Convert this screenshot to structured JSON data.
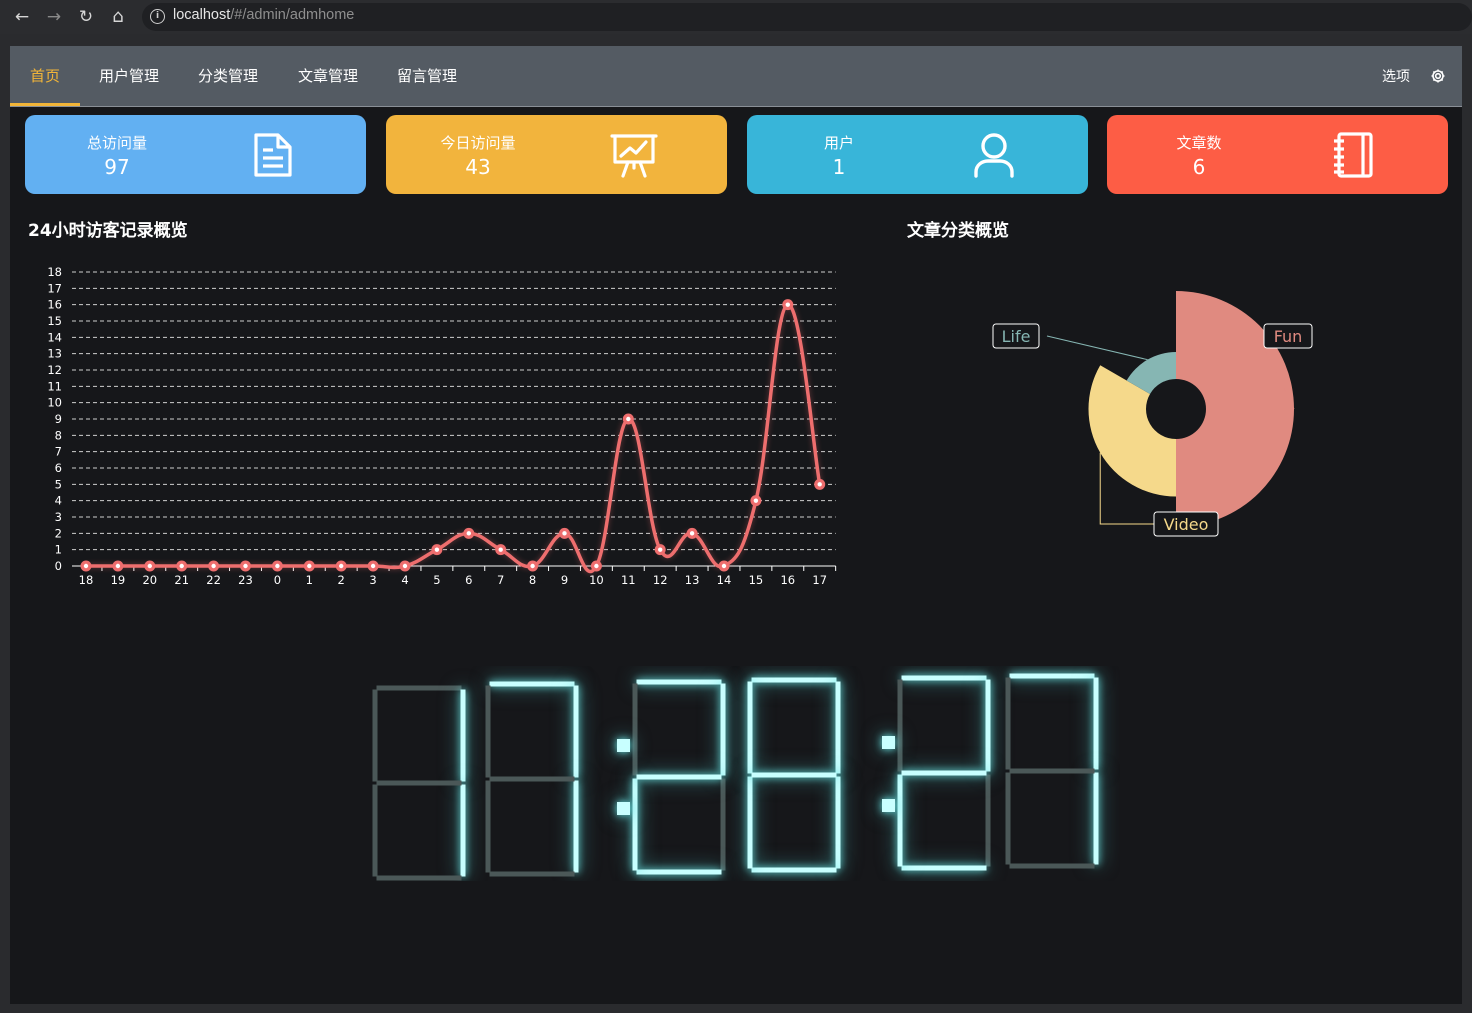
{
  "browser": {
    "url_host": "localhost",
    "url_path": "/#/admin/admhome",
    "icons": [
      "back-arrow-icon",
      "forward-arrow-icon",
      "reload-icon",
      "home-icon",
      "info-icon"
    ]
  },
  "nav": {
    "items": [
      {
        "label": "首页",
        "active": true
      },
      {
        "label": "用户管理",
        "active": false
      },
      {
        "label": "分类管理",
        "active": false
      },
      {
        "label": "文章管理",
        "active": false
      },
      {
        "label": "留言管理",
        "active": false
      }
    ],
    "options_label": "选项",
    "active_color": "#f2b538"
  },
  "cards": [
    {
      "label": "总访问量",
      "value": "97",
      "color": "#62b0f2",
      "icon": "document-icon"
    },
    {
      "label": "今日访问量",
      "value": "43",
      "color": "#f2b43d",
      "icon": "presentation-chart-icon"
    },
    {
      "label": "用户",
      "value": "1",
      "color": "#38b5d9",
      "icon": "user-icon"
    },
    {
      "label": "文章数",
      "value": "6",
      "color": "#fd5d45",
      "icon": "notebook-icon"
    }
  ],
  "sections": {
    "visits_title": "24小时访客记录概览",
    "category_title": "文章分类概览"
  },
  "chart_data": [
    {
      "type": "line",
      "title": "24小时访客记录概览",
      "categories": [
        "18",
        "19",
        "20",
        "21",
        "22",
        "23",
        "0",
        "1",
        "2",
        "3",
        "4",
        "5",
        "6",
        "7",
        "8",
        "9",
        "10",
        "11",
        "12",
        "13",
        "14",
        "15",
        "16",
        "17"
      ],
      "series": [
        {
          "values": [
            0,
            0,
            0,
            0,
            0,
            0,
            0,
            0,
            0,
            0,
            0,
            1,
            2,
            1,
            0,
            2,
            0,
            9,
            1,
            2,
            0,
            4,
            16,
            5
          ]
        }
      ],
      "ylim": [
        0,
        18
      ],
      "y_ticks": [
        0,
        1,
        2,
        3,
        4,
        5,
        6,
        7,
        8,
        9,
        10,
        11,
        12,
        13,
        14,
        15,
        16,
        17,
        18
      ],
      "smooth": true,
      "grid": "dashed horizontal",
      "color": "#ee6e6e"
    },
    {
      "type": "pie",
      "title": "文章分类概览",
      "rose": true,
      "slices": [
        {
          "label": "Fun",
          "value": 3,
          "color": "#e08a80"
        },
        {
          "label": "Video",
          "value": 2,
          "color": "#f5d98b"
        },
        {
          "label": "Life",
          "value": 1,
          "color": "#86b6b3"
        }
      ]
    }
  ],
  "clock": {
    "digits": [
      "1",
      "7",
      "2",
      "8",
      "2",
      "7"
    ],
    "text": "17:28:27",
    "color": "#c8ffff"
  }
}
